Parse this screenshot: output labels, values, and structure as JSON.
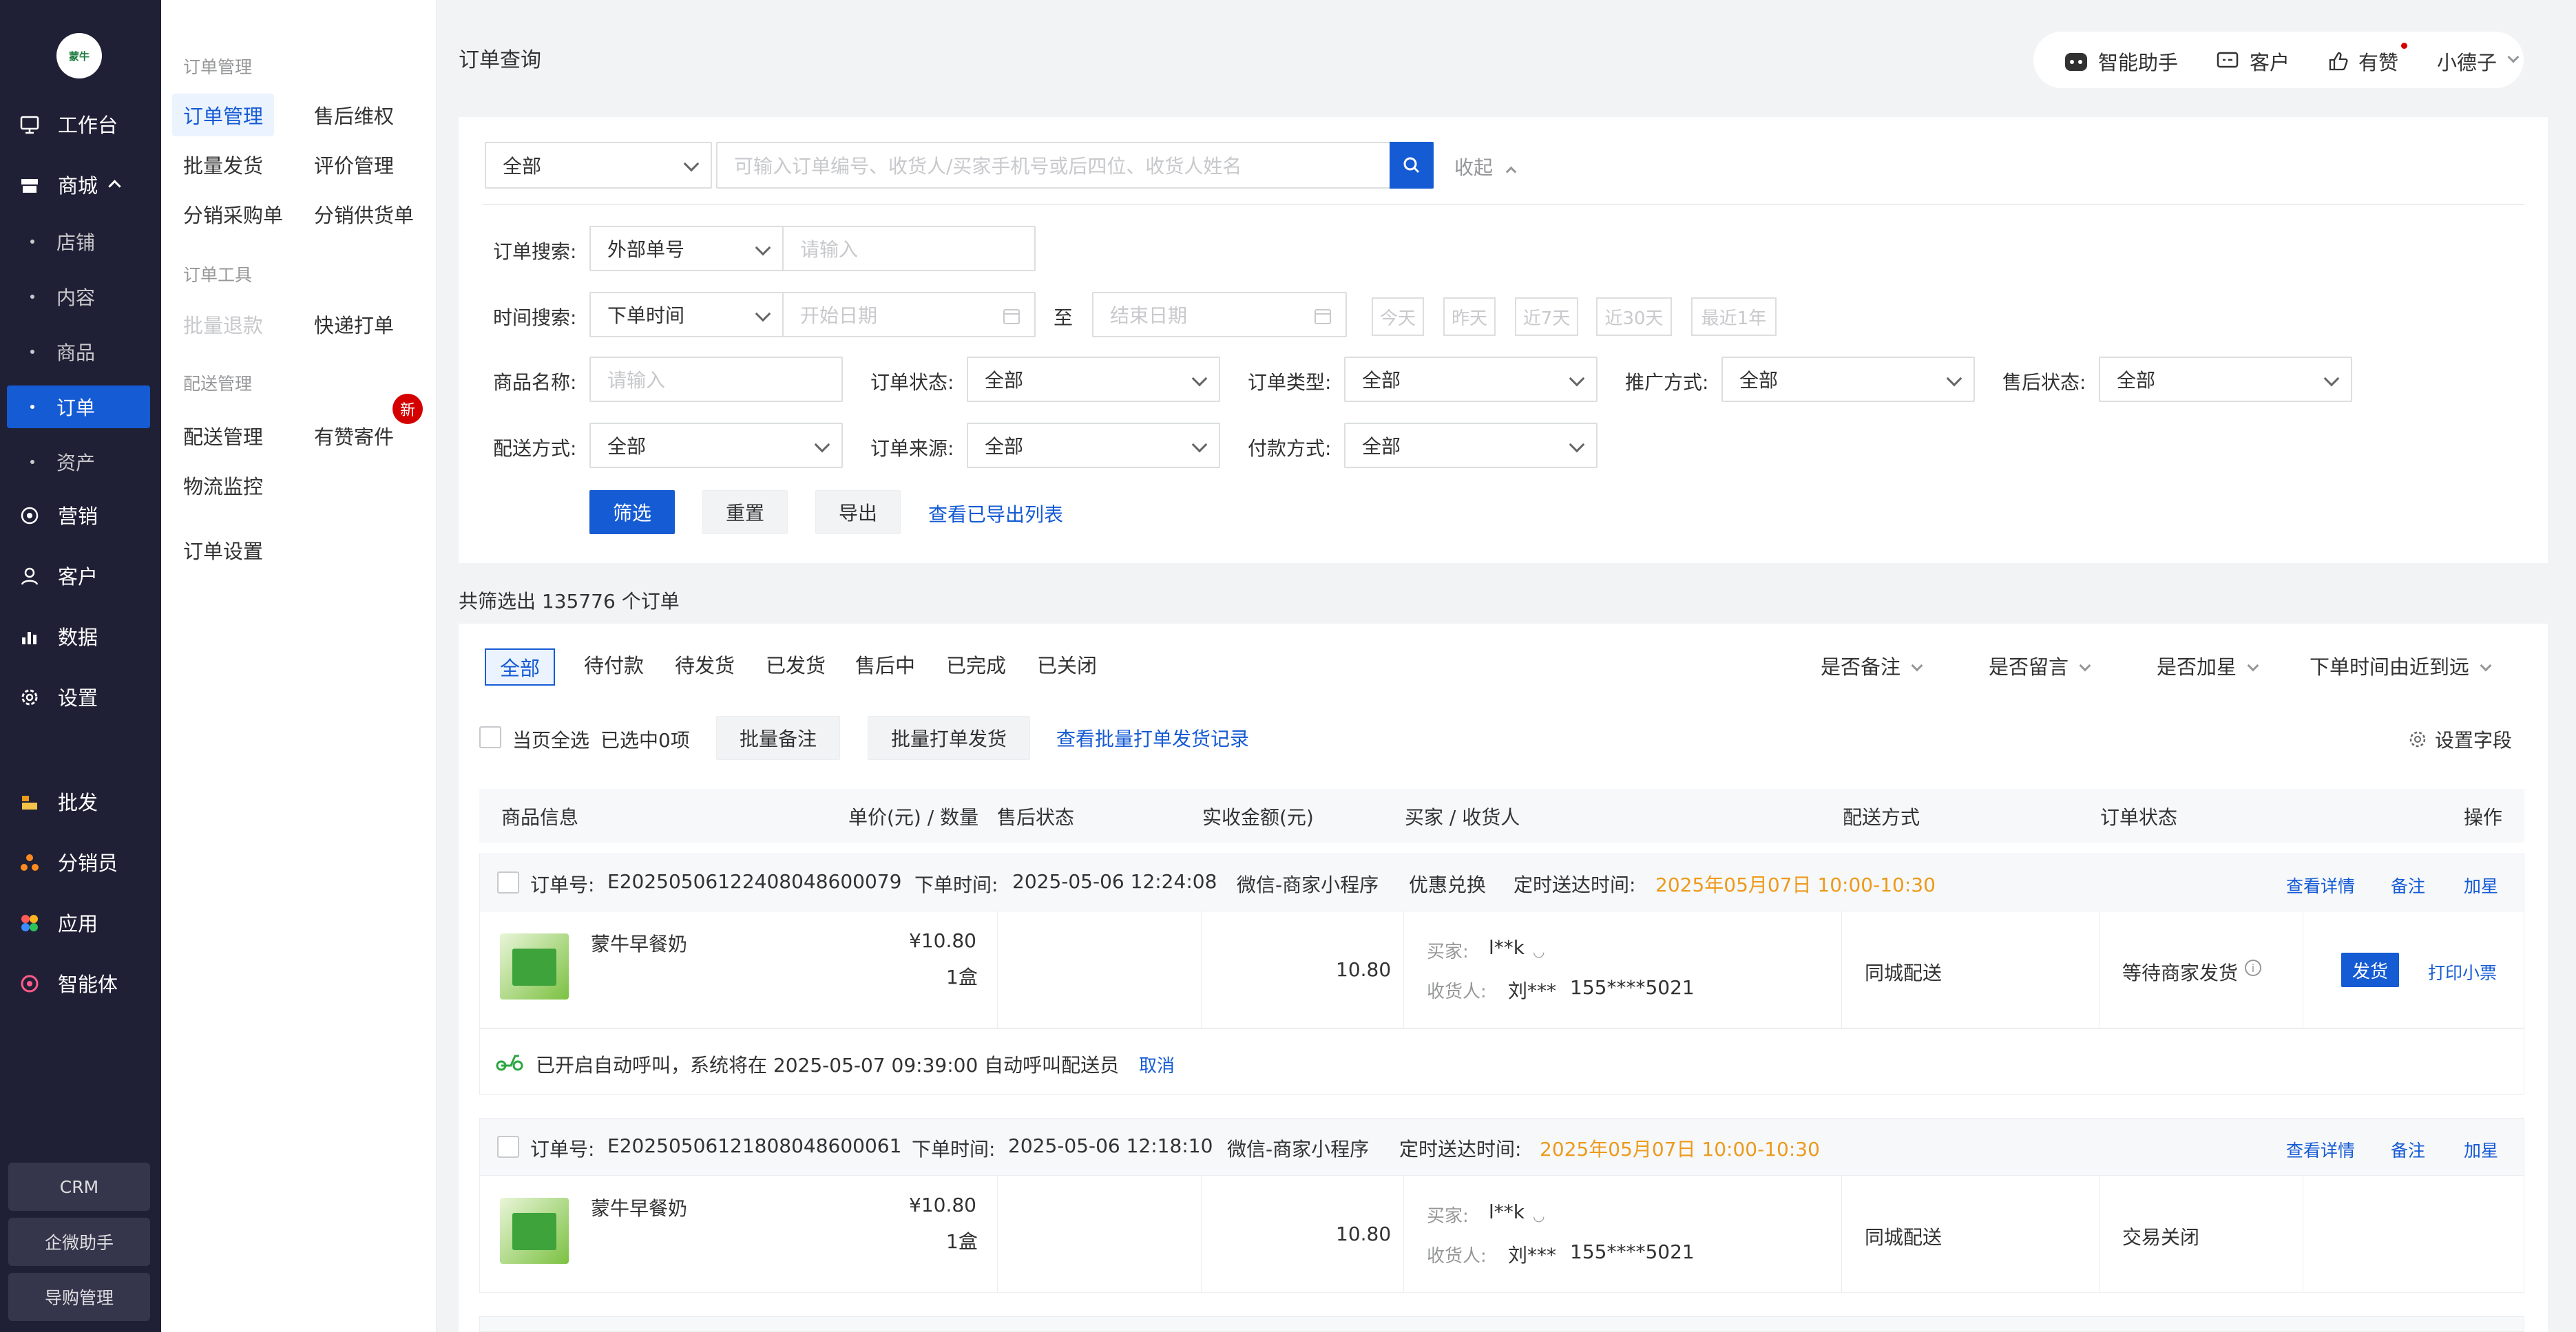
{
  "sidebar": {
    "logo_text": "蒙牛",
    "items": [
      {
        "label": "工作台",
        "icon": "workbench-icon"
      },
      {
        "label": "商城",
        "icon": "store-icon"
      },
      {
        "label": "营销",
        "icon": "marketing-icon"
      },
      {
        "label": "客户",
        "icon": "user-icon"
      },
      {
        "label": "数据",
        "icon": "chart-icon"
      },
      {
        "label": "设置",
        "icon": "gear-icon"
      },
      {
        "label": "批发",
        "icon": "wholesale-icon"
      },
      {
        "label": "分销员",
        "icon": "distributor-icon"
      },
      {
        "label": "应用",
        "icon": "apps-icon"
      },
      {
        "label": "智能体",
        "icon": "agent-icon"
      }
    ],
    "sub_items": [
      "店铺",
      "内容",
      "商品",
      "订单",
      "资产"
    ],
    "bottom_buttons": [
      "CRM",
      "企微助手",
      "导购管理"
    ]
  },
  "subnav": {
    "group1_title": "订单管理",
    "group1_links": [
      "订单管理",
      "售后维权",
      "批量发货",
      "评价管理",
      "分销采购单",
      "分销供货单"
    ],
    "group2_title": "订单工具",
    "group2_links": [
      "批量退款",
      "快递打单"
    ],
    "group3_title": "配送管理",
    "group3_links": [
      "配送管理",
      "有赞寄件",
      "物流监控"
    ],
    "new_badge": "新",
    "settings_link": "订单设置"
  },
  "header": {
    "title": "订单查询",
    "assistant": "智能助手",
    "customer": "客户",
    "youzan": "有赞",
    "user": "小德子"
  },
  "search": {
    "scope": "全部",
    "placeholder": "可输入订单编号、收货人/买家手机号或后四位、收货人姓名",
    "collapse": "收起"
  },
  "filters": {
    "order_search_label": "订单搜索:",
    "order_search_type": "外部单号",
    "order_search_placeholder": "请输入",
    "time_label": "时间搜索:",
    "time_type": "下单时间",
    "start_placeholder": "开始日期",
    "to": "至",
    "end_placeholder": "结束日期",
    "quick": [
      "今天",
      "昨天",
      "近7天",
      "近30天",
      "最近1年"
    ],
    "product_label": "商品名称:",
    "product_placeholder": "请输入",
    "order_status_label": "订单状态:",
    "order_status": "全部",
    "order_type_label": "订单类型:",
    "order_type": "全部",
    "promo_label": "推广方式:",
    "promo": "全部",
    "after_sale_label": "售后状态:",
    "after_sale": "全部",
    "delivery_label": "配送方式:",
    "delivery": "全部",
    "source_label": "订单来源:",
    "source": "全部",
    "payment_label": "付款方式:",
    "payment": "全部",
    "filter_btn": "筛选",
    "reset_btn": "重置",
    "export_btn": "导出",
    "export_list_link": "查看已导出列表"
  },
  "result_count": "共筛选出 135776 个订单",
  "tabs": [
    "全部",
    "待付款",
    "待发货",
    "已发货",
    "售后中",
    "已完成",
    "已关闭"
  ],
  "dropdowns": [
    "是否备注",
    "是否留言",
    "是否加星",
    "下单时间由近到远"
  ],
  "bulk": {
    "select_page": "当页全选",
    "selected": "已选中0项",
    "batch_note": "批量备注",
    "batch_print": "批量打单发货",
    "batch_record_link": "查看批量打单发货记录",
    "set_fields": "设置字段"
  },
  "table_headers": [
    "商品信息",
    "单价(元) / 数量",
    "售后状态",
    "实收金额(元)",
    "买家 / 收货人",
    "配送方式",
    "订单状态",
    "操作"
  ],
  "orders": [
    {
      "order_no_label": "订单号:",
      "order_no": "E20250506122408048600079",
      "time_label": "下单时间:",
      "time": "2025-05-06 12:24:08",
      "channel": "微信-商家小程序",
      "promo": "优惠兑换",
      "scheduled_label": "定时送达时间:",
      "scheduled": "2025年05月07日 10:00-10:30",
      "view_detail": "查看详情",
      "note": "备注",
      "star": "加星",
      "product_name": "蒙牛早餐奶",
      "price": "¥10.80",
      "qty": "1盒",
      "amount": "10.80",
      "buyer_label": "买家:",
      "buyer": "l**k",
      "receiver_label": "收货人:",
      "receiver_name": "刘***",
      "receiver_phone": "155****5021",
      "delivery": "同城配送",
      "status": "等待商家发货",
      "ship_btn": "发货",
      "print_link": "打印小票",
      "auto_call_text": "已开启自动呼叫，系统将在 2025-05-07 09:39:00 自动呼叫配送员",
      "cancel": "取消"
    },
    {
      "order_no_label": "订单号:",
      "order_no": "E20250506121808048600061",
      "time_label": "下单时间:",
      "time": "2025-05-06 12:18:10",
      "channel": "微信-商家小程序",
      "scheduled_label": "定时送达时间:",
      "scheduled": "2025年05月07日 10:00-10:30",
      "view_detail": "查看详情",
      "note": "备注",
      "star": "加星",
      "product_name": "蒙牛早餐奶",
      "price": "¥10.80",
      "qty": "1盒",
      "amount": "10.80",
      "buyer_label": "买家:",
      "buyer": "l**k",
      "receiver_label": "收货人:",
      "receiver_name": "刘***",
      "receiver_phone": "155****5021",
      "delivery": "同城配送",
      "status": "交易关闭"
    }
  ],
  "colors": {
    "primary": "#155bd4",
    "sidebar_bg": "#1f2035",
    "orange": "#ed9a1b"
  }
}
